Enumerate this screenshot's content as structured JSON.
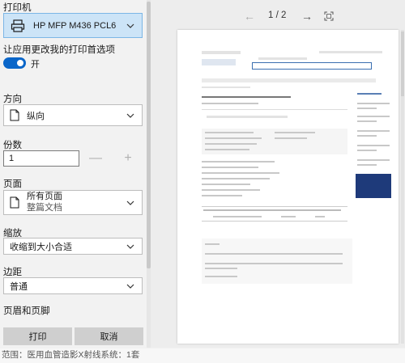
{
  "printer": {
    "label": "打印机",
    "name": "HP MFP M436 PCL6"
  },
  "app_change": {
    "label": "让应用更改我的打印首选项",
    "state": "开"
  },
  "orientation": {
    "label": "方向",
    "value": "纵向"
  },
  "copies": {
    "label": "份数",
    "value": "1",
    "minus": "—",
    "plus": "+"
  },
  "pages": {
    "label": "页面",
    "value_line1": "所有页面",
    "value_line2": "整篇文档"
  },
  "scale": {
    "label": "缩放",
    "value": "收缩到大小合适"
  },
  "margins": {
    "label": "边距",
    "value": "普通"
  },
  "header_footer": {
    "label": "页眉和页脚"
  },
  "actions": {
    "print": "打印",
    "cancel": "取消"
  },
  "preview": {
    "page_indicator": "1 / 2",
    "prev": "←",
    "next": "→"
  },
  "footer_status": "范围：医用血管造影X射线系统：1套",
  "colors": {
    "accent": "#0a66c9",
    "printer_bg": "#cce4f7",
    "button_bg": "#cfcfcf"
  },
  "icons": {
    "printer": "printer-icon",
    "portrait": "portrait-page-icon",
    "pages": "document-icon",
    "chevron": "chevron-down-icon",
    "fit": "fit-page-icon"
  }
}
